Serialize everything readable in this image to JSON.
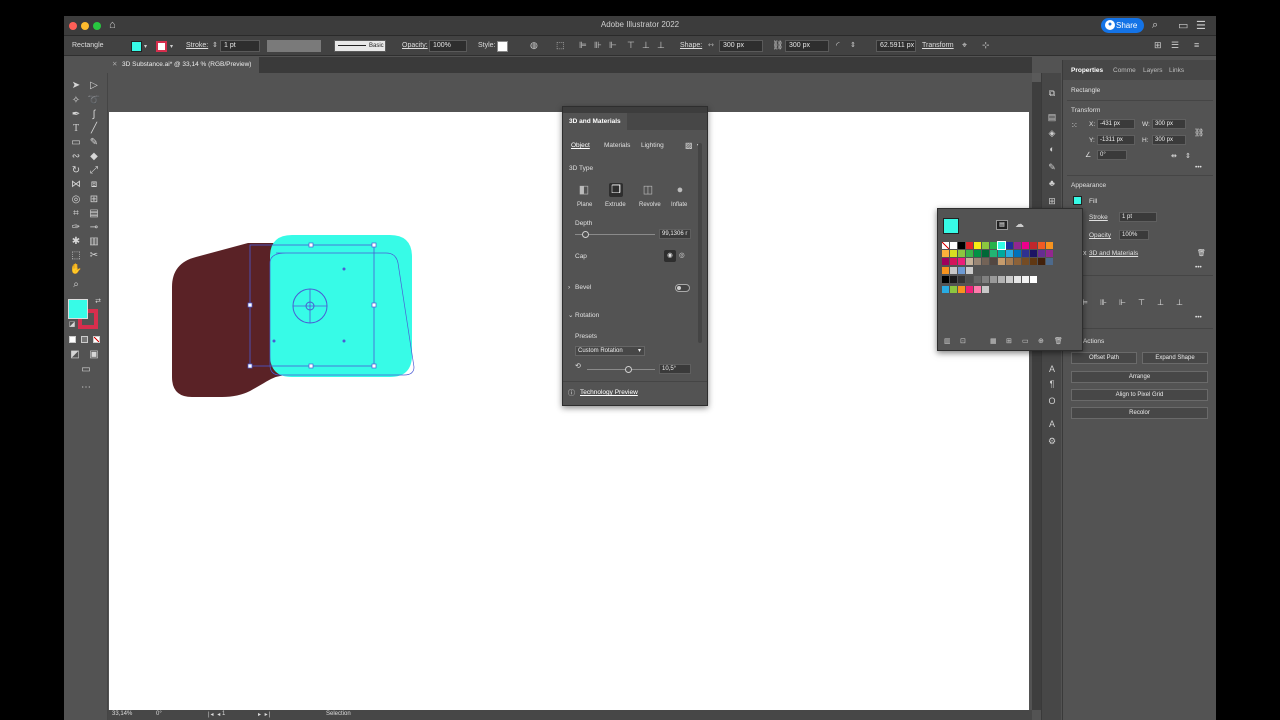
{
  "app": {
    "title": "Adobe Illustrator 2022",
    "share_label": "Share"
  },
  "control_bar": {
    "selection_type": "Rectangle",
    "fill_color": "#37fbe7",
    "stroke_color": "#d62e4d",
    "stroke_label": "Stroke:",
    "stroke_weight": "1 pt",
    "brush_label": "Basic",
    "opacity_label": "Opacity:",
    "opacity_value": "100%",
    "style_label": "Style:",
    "shape_label": "Shape:",
    "shape_width": "300 px",
    "shape_height": "300 px",
    "corner_value": "62.5911 px",
    "transform_label": "Transform"
  },
  "document": {
    "tab_title": "3D Substance.ai* @ 33,14 % (RGB/Preview)",
    "close_glyph": "✕"
  },
  "status_bar": {
    "zoom": "33,14%",
    "rotation": "0°",
    "artboard_num": "1",
    "tool": "Selection"
  },
  "panel_3d": {
    "title": "3D and Materials",
    "tabs": [
      "Object",
      "Materials",
      "Lighting"
    ],
    "type_heading": "3D Type",
    "types": [
      "Plane",
      "Extrude",
      "Revolve",
      "Inflate"
    ],
    "depth_label": "Depth",
    "depth_value": "99,1306 r",
    "depth_level": 0.12,
    "cap_label": "Cap",
    "bevel_label": "Bevel",
    "rotation_label": "Rotation",
    "presets_label": "Presets",
    "preset_value": "Custom Rotation",
    "rotation_value": "10,5°",
    "rotation_level": 0.6,
    "tech_preview": "Technology Preview"
  },
  "properties": {
    "tabs": [
      "Properties",
      "Comme",
      "Layers",
      "Links"
    ],
    "selection_type": "Rectangle",
    "transform_heading": "Transform",
    "x_label": "X:",
    "x_value": "-431 px",
    "y_label": "Y:",
    "y_value": "-1311 px",
    "w_label": "W:",
    "w_value": "300 px",
    "h_label": "H:",
    "h_value": "300 px",
    "angle_value": "0°",
    "appearance_heading": "Appearance",
    "fill_label": "Fill",
    "stroke_label": "Stroke",
    "stroke_value": "1 pt",
    "opacity_label": "Opacity",
    "opacity_value": "100%",
    "effect_label": "3D and Materials",
    "quick_actions_heading": "ck Actions",
    "buttons": [
      "Offset Path",
      "Expand Shape",
      "Arrange",
      "Align to Pixel Grid",
      "Recolor"
    ]
  },
  "swatches": {
    "selected_color": "#37fbe7",
    "rows": [
      [
        "#ffffff",
        "#ffffff",
        "#000000",
        "#e1262b",
        "#f7ec13",
        "#8cc63f",
        "#28b24b",
        "#35fde6",
        "#1f2f9a",
        "#92278f",
        "#ec008c",
        "#c1272d",
        "#f15a24",
        "#f7931e"
      ],
      [
        "#fbb03b",
        "#d9e021",
        "#8cc63f",
        "#39b54a",
        "#009245",
        "#006837",
        "#22b573",
        "#00a99d",
        "#29abe2",
        "#0071bc",
        "#2e3192",
        "#1b1464",
        "#662d91",
        "#93278f"
      ],
      [
        "#9e005d",
        "#d4145a",
        "#ed1e79",
        "#c7b299",
        "#998675",
        "#736357",
        "#534741",
        "#c69c6d",
        "#a67c52",
        "#8c6239",
        "#754c24",
        "#603813",
        "#42210b",
        "#4d6a8c"
      ],
      [
        "#f7931e",
        "#c8c8c8",
        "#6d9ad3",
        "#cccccc"
      ],
      [
        "#000000",
        "#1a1a1a",
        "#333333",
        "#4d4d4d",
        "#666666",
        "#808080",
        "#999999",
        "#b3b3b3",
        "#cccccc",
        "#e6e6e6",
        "#f2f2f2",
        "#ffffff"
      ],
      [
        "#29abe2",
        "#8cc63f",
        "#f7931e",
        "#ed1e79",
        "#ff7bac",
        "#c8c8c8"
      ]
    ]
  },
  "art": {
    "face_color": "#37fbe7",
    "side_color": "#5a2226"
  }
}
